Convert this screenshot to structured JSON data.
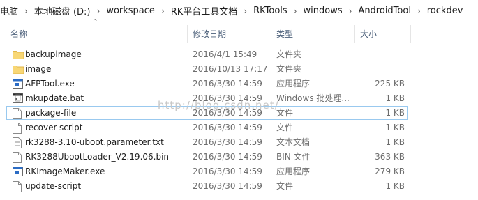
{
  "breadcrumb": {
    "items": [
      "电脑",
      "本地磁盘 (D:)",
      "workspace",
      "RK平台工具文档",
      "RKTools",
      "windows",
      "AndroidTool",
      "rockdev"
    ],
    "separator": "›"
  },
  "columns": {
    "name": "名称",
    "date": "修改日期",
    "type": "类型",
    "size": "大小"
  },
  "files": [
    {
      "name": "backupimage",
      "date": "2016/4/1 15:49",
      "type": "文件夹",
      "size": "",
      "icon": "folder-icon"
    },
    {
      "name": "image",
      "date": "2016/10/13 17:17",
      "type": "文件夹",
      "size": "",
      "icon": "folder-icon"
    },
    {
      "name": "AFPTool.exe",
      "date": "2016/3/30 14:59",
      "type": "应用程序",
      "size": "225 KB",
      "icon": "exe-icon"
    },
    {
      "name": "mkupdate.bat",
      "date": "2016/3/30 14:59",
      "type": "Windows 批处理...",
      "size": "1 KB",
      "icon": "bat-icon"
    },
    {
      "name": "package-file",
      "date": "2016/3/30 14:59",
      "type": "文件",
      "size": "1 KB",
      "icon": "file-icon"
    },
    {
      "name": "recover-script",
      "date": "2016/3/30 14:59",
      "type": "文件",
      "size": "1 KB",
      "icon": "file-icon"
    },
    {
      "name": "rk3288-3.10-uboot.parameter.txt",
      "date": "2016/3/30 14:59",
      "type": "文本文档",
      "size": "1 KB",
      "icon": "text-file-icon"
    },
    {
      "name": "RK3288UbootLoader_V2.19.06.bin",
      "date": "2016/3/30 14:59",
      "type": "BIN 文件",
      "size": "363 KB",
      "icon": "file-icon"
    },
    {
      "name": "RKImageMaker.exe",
      "date": "2016/3/30 14:59",
      "type": "应用程序",
      "size": "279 KB",
      "icon": "exe-icon"
    },
    {
      "name": "update-script",
      "date": "2016/3/30 14:59",
      "type": "文件",
      "size": "1 KB",
      "icon": "file-icon"
    }
  ],
  "focused_index": 4,
  "watermark": "http://blog.csdn.net/",
  "colors": {
    "folder": "#f8d775",
    "folder_dark": "#e0b64a",
    "exe_blue": "#2b6cc4",
    "focus_border": "#99c9ef",
    "header_text": "#4c607a"
  }
}
